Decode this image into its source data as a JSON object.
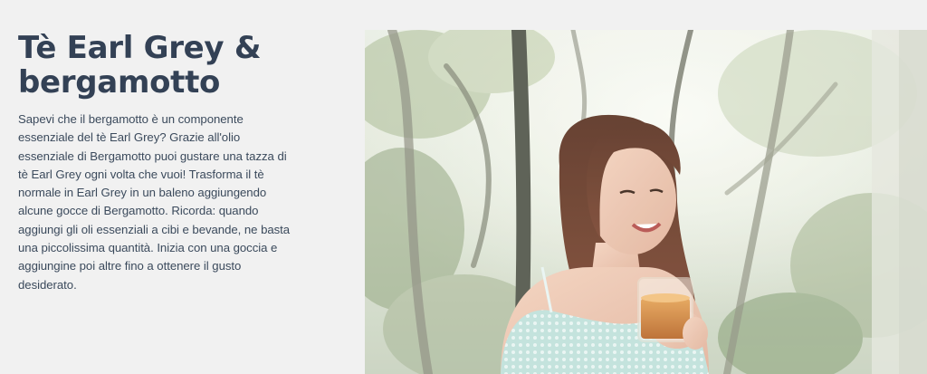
{
  "section": {
    "title": "Tè Earl Grey & bergamotto",
    "body": "Sapevi che il bergamotto è un componente essenziale del tè Earl Grey? Grazie all'olio essenziale di Bergamotto puoi gustare una tazza di tè Earl Grey ogni volta che vuoi! Trasforma il tè normale in Earl Grey in un baleno aggiungendo alcune gocce di Bergamotto. Ricorda: quando aggiungi gli oli essenziali a cibi e bevande, ne basta una piccolissima quantità. Inizia con una goccia e aggiungine poi altre fino a ottenere il gusto desiderato."
  },
  "colors": {
    "page_background": "#f1f1f1",
    "heading": "#334155",
    "body_text": "#3b4a5c"
  }
}
